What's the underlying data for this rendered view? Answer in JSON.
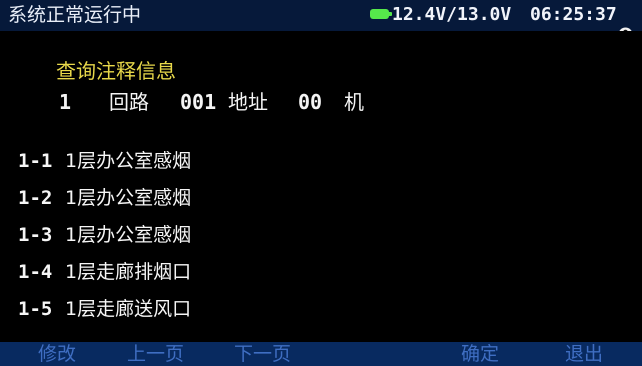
{
  "status_bar": {
    "system_status": "系统正常运行中",
    "voltage": "12.4V/13.0V",
    "time": "06:25:37"
  },
  "screen": {
    "title": "查询注释信息",
    "query": {
      "loop_number": "1",
      "loop_label": "回路",
      "address_number": "001",
      "address_label": "地址",
      "device_number": "00",
      "device_label": "机"
    }
  },
  "annotations": [
    {
      "code": "1-1",
      "description": "1层办公室感烟"
    },
    {
      "code": "1-2",
      "description": "1层办公室感烟"
    },
    {
      "code": "1-3",
      "description": "1层办公室感烟"
    },
    {
      "code": "1-4",
      "description": "1层走廊排烟口"
    },
    {
      "code": "1-5",
      "description": "1层走廊送风口"
    }
  ],
  "softkeys": {
    "modify": "修改",
    "previous_page": "上一页",
    "next_page": "下一页",
    "confirm": "确定",
    "exit": "退出"
  },
  "colors": {
    "title": "#e8d84a",
    "battery": "#56e84b",
    "softkey_text": "#3f6ec2",
    "header_background": "#061a3d"
  },
  "icons": {
    "battery": "battery-icon",
    "user": "user-icon"
  }
}
